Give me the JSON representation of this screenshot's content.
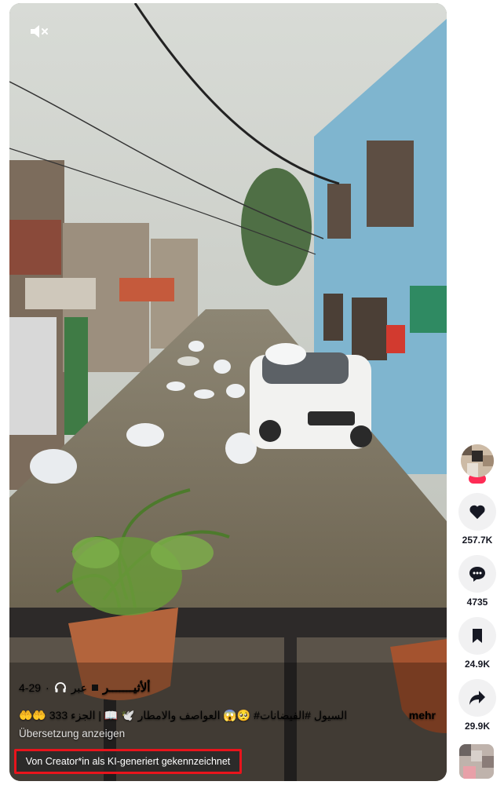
{
  "video": {
    "meta": {
      "author": "ألأثيـــــــر",
      "via": "عبر",
      "date": "4-29"
    },
    "caption": "السيول #الفيضانات# 🥺😱 العواصف والامطار 🕊️ 📖 | الجزء 333 🤲🤲",
    "more_label": "mehr",
    "translate_label": "Übersetzung anzeigen",
    "ai_label": "Von Creator*in als KI-generiert gekennzeichnet",
    "mute_icon": "speaker-muted-icon"
  },
  "actions": {
    "likes": "257.7K",
    "comments": "4735",
    "saves": "24.9K",
    "shares": "29.9K"
  },
  "colors": {
    "accent_red": "#e8141c",
    "rail_button": "#f1f1f2",
    "count_text": "#161823"
  }
}
